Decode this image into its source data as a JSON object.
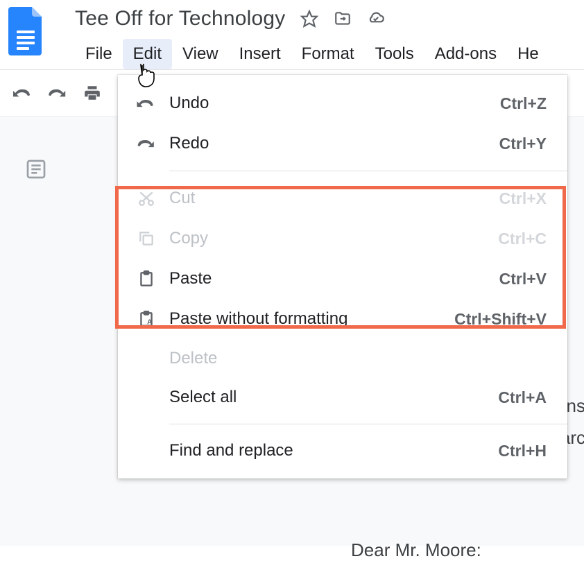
{
  "document": {
    "title": "Tee Off for Technology",
    "body_fragments": [
      "ns",
      "arc",
      "Dear Mr. Moore:"
    ]
  },
  "menu": {
    "file": "File",
    "edit": "Edit",
    "view": "View",
    "insert": "Insert",
    "format": "Format",
    "tools": "Tools",
    "addons": "Add-ons",
    "help_fragment": "He"
  },
  "edit_menu": {
    "undo": {
      "label": "Undo",
      "shortcut": "Ctrl+Z"
    },
    "redo": {
      "label": "Redo",
      "shortcut": "Ctrl+Y"
    },
    "cut": {
      "label": "Cut",
      "shortcut": "Ctrl+X"
    },
    "copy": {
      "label": "Copy",
      "shortcut": "Ctrl+C"
    },
    "paste": {
      "label": "Paste",
      "shortcut": "Ctrl+V"
    },
    "paste_nf": {
      "label": "Paste without formatting",
      "shortcut": "Ctrl+Shift+V"
    },
    "delete": {
      "label": "Delete"
    },
    "select_all": {
      "label": "Select all",
      "shortcut": "Ctrl+A"
    },
    "find_replace": {
      "label": "Find and replace",
      "shortcut": "Ctrl+H"
    }
  }
}
